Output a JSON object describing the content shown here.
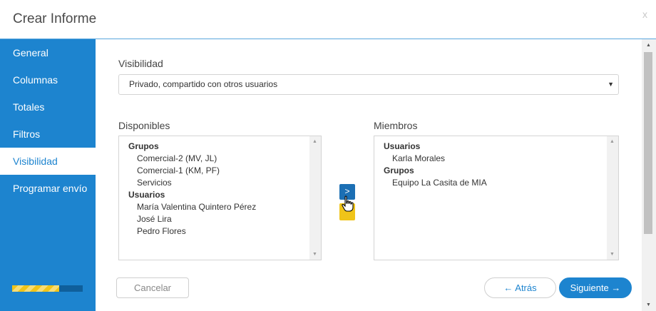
{
  "dialog": {
    "title": "Crear Informe",
    "close_label": "x"
  },
  "sidebar": {
    "items": [
      {
        "label": "General"
      },
      {
        "label": "Columnas"
      },
      {
        "label": "Totales"
      },
      {
        "label": "Filtros"
      },
      {
        "label": "Visibilidad",
        "active": true
      },
      {
        "label": "Programar envío"
      }
    ],
    "progress_fraction": 0.67
  },
  "visibility": {
    "label": "Visibilidad",
    "selected": "Privado, compartido con otros usuarios"
  },
  "available": {
    "label": "Disponibles",
    "groups_header": "Grupos",
    "groups": [
      "Comercial-2 (MV, JL)",
      "Comercial-1 (KM, PF)",
      "Servicios"
    ],
    "users_header": "Usuarios",
    "users": [
      "María Valentina Quintero Pérez",
      "José Lira",
      "Pedro Flores"
    ]
  },
  "members": {
    "label": "Miembros",
    "users_header": "Usuarios",
    "users": [
      "Karla Morales"
    ],
    "groups_header": "Grupos",
    "groups": [
      "Equipo La Casita de MIA"
    ]
  },
  "transfer": {
    "add_glyph": ">"
  },
  "buttons": {
    "cancel": "Cancelar",
    "back": "← Atrás",
    "next": "Siguiente →"
  },
  "colors": {
    "accent": "#1d84cf",
    "highlight": "#f0c419"
  }
}
